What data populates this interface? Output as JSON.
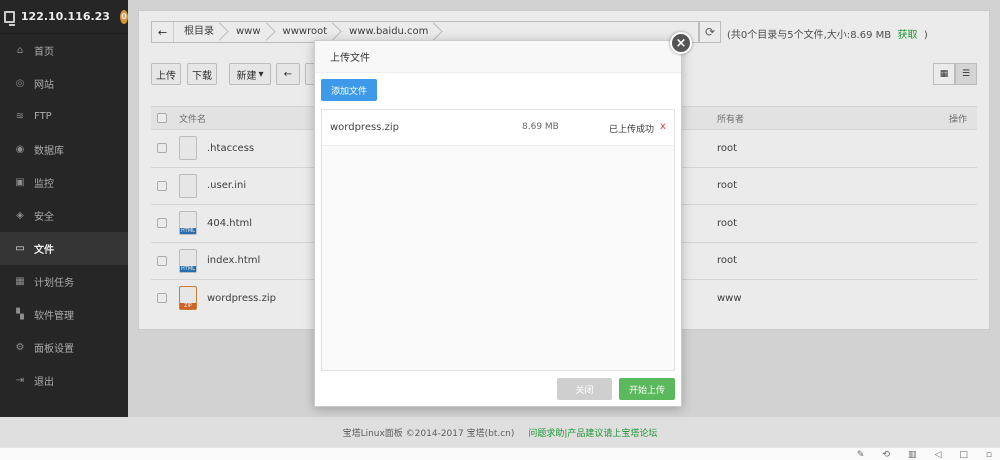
{
  "sidebar": {
    "ip": "122.10.116.23",
    "badge": "0",
    "items": [
      {
        "label": "首页",
        "icon": "home-icon",
        "glyph": "⌂"
      },
      {
        "label": "网站",
        "icon": "globe-icon",
        "glyph": "◎"
      },
      {
        "label": "FTP",
        "icon": "ftp-icon",
        "glyph": "≋"
      },
      {
        "label": "数据库",
        "icon": "database-icon",
        "glyph": "◉"
      },
      {
        "label": "监控",
        "icon": "monitor-chart-icon",
        "glyph": "▣"
      },
      {
        "label": "安全",
        "icon": "shield-icon",
        "glyph": "◈"
      },
      {
        "label": "文件",
        "icon": "folder-icon",
        "glyph": "▭",
        "active": true
      },
      {
        "label": "计划任务",
        "icon": "calendar-icon",
        "glyph": "▦"
      },
      {
        "label": "软件管理",
        "icon": "software-icon",
        "glyph": "▚"
      },
      {
        "label": "面板设置",
        "icon": "settings-icon",
        "glyph": "⚙"
      },
      {
        "label": "退出",
        "icon": "logout-icon",
        "glyph": "⇥"
      }
    ]
  },
  "path": {
    "crumbs": [
      "根目录",
      "www",
      "wwwroot",
      "www.baidu.com"
    ],
    "info_prefix": "(共0个目录与5个文件,大小:",
    "info_size": "8.69 MB",
    "info_link": "获取",
    "info_suffix": ")"
  },
  "toolbar": {
    "upload": "上传",
    "download": "下载",
    "new": "新建",
    "new_caret": "▾",
    "back": "←"
  },
  "table": {
    "col_name": "文件名",
    "col_owner": "所有者",
    "col_ops": "操作",
    "rows": [
      {
        "name": ".htaccess",
        "owner": "root",
        "type": "blank"
      },
      {
        "name": ".user.ini",
        "owner": "root",
        "type": "blank"
      },
      {
        "name": "404.html",
        "owner": "root",
        "type": "html"
      },
      {
        "name": "index.html",
        "owner": "root",
        "type": "html"
      },
      {
        "name": "wordpress.zip",
        "owner": "www",
        "type": "zip"
      }
    ]
  },
  "modal": {
    "title": "上传文件",
    "add_label": "添加文件",
    "file": {
      "name": "wordpress.zip",
      "size": "8.69 MB",
      "status": "已上传成功",
      "remove": "x"
    },
    "close_label": "关闭",
    "start_label": "开始上传",
    "close_icon": "×"
  },
  "footer": {
    "copyright": "宝塔Linux面板 ©2014-2017 宝塔(bt.cn)",
    "link": "问题求助|产品建议请上宝塔论坛"
  },
  "colors": {
    "accent_green": "#20a53a",
    "button_blue": "#3e9ae8",
    "start_green": "#5cb85c",
    "remove_red": "#e04444"
  }
}
